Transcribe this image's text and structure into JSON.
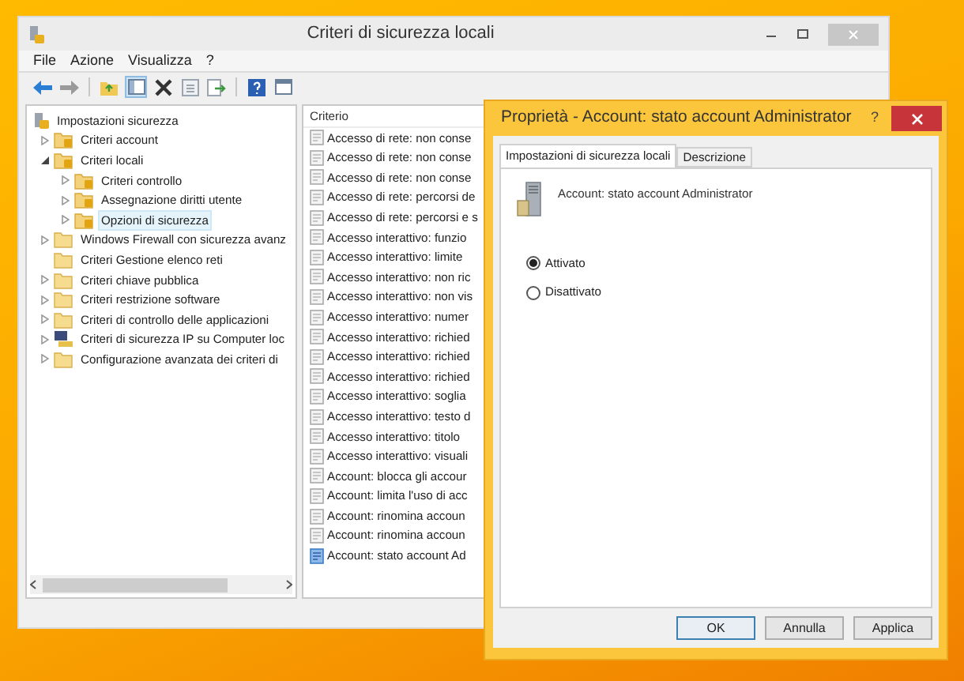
{
  "window": {
    "title": "Criteri di sicurezza locali"
  },
  "menu": [
    "File",
    "Azione",
    "Visualizza",
    "?"
  ],
  "tree": [
    {
      "label": "Impostazioni sicurezza",
      "kind": "root",
      "selected": false,
      "children": [
        {
          "label": "Criteri account",
          "kind": "lock-folder",
          "expanded": false,
          "selected": false
        },
        {
          "label": "Criteri locali",
          "kind": "lock-folder",
          "expanded": true,
          "selected": false,
          "children": [
            {
              "label": "Criteri controllo",
              "kind": "lock-folder",
              "expanded": false,
              "selected": false
            },
            {
              "label": "Assegnazione diritti utente",
              "kind": "lock-folder",
              "expanded": false,
              "selected": false
            },
            {
              "label": "Opzioni di sicurezza",
              "kind": "lock-folder",
              "expanded": false,
              "selected": true
            }
          ]
        },
        {
          "label": "Windows Firewall con sicurezza avanz",
          "kind": "folder",
          "expanded": false,
          "selected": false
        },
        {
          "label": "Criteri Gestione elenco reti",
          "kind": "folder",
          "selected": false
        },
        {
          "label": "Criteri chiave pubblica",
          "kind": "folder",
          "expanded": false,
          "selected": false
        },
        {
          "label": "Criteri restrizione software",
          "kind": "folder",
          "expanded": false,
          "selected": false
        },
        {
          "label": "Criteri di controllo delle applicazioni",
          "kind": "folder",
          "expanded": false,
          "selected": false
        },
        {
          "label": "Criteri di sicurezza IP su Computer loc",
          "kind": "ip",
          "expanded": false,
          "selected": false
        },
        {
          "label": "Configurazione avanzata dei criteri di",
          "kind": "folder",
          "expanded": false,
          "selected": false
        }
      ]
    }
  ],
  "list": {
    "columns": [
      "Criterio"
    ],
    "rows": [
      {
        "label": "Accesso di rete: non conse",
        "selected": false
      },
      {
        "label": "Accesso di rete: non conse",
        "selected": false
      },
      {
        "label": "Accesso di rete: non conse",
        "selected": false
      },
      {
        "label": "Accesso di rete: percorsi de",
        "selected": false
      },
      {
        "label": "Accesso di rete: percorsi e s",
        "selected": false
      },
      {
        "label": "Accesso interattivo: funzio",
        "selected": false
      },
      {
        "label": "Accesso interattivo: limite",
        "selected": false
      },
      {
        "label": "Accesso interattivo: non ric",
        "selected": false
      },
      {
        "label": "Accesso interattivo: non vis",
        "selected": false
      },
      {
        "label": "Accesso interattivo: numer",
        "selected": false
      },
      {
        "label": "Accesso interattivo: richied",
        "selected": false
      },
      {
        "label": "Accesso interattivo: richied",
        "selected": false
      },
      {
        "label": "Accesso interattivo: richied",
        "selected": false
      },
      {
        "label": "Accesso interattivo: soglia",
        "selected": false
      },
      {
        "label": "Accesso interattivo: testo d",
        "selected": false
      },
      {
        "label": "Accesso interattivo: titolo",
        "selected": false
      },
      {
        "label": "Accesso interattivo: visuali",
        "selected": false
      },
      {
        "label": "Account: blocca gli accour",
        "selected": false
      },
      {
        "label": "Account: limita l'uso di acc",
        "selected": false
      },
      {
        "label": "Account: rinomina accoun",
        "selected": false
      },
      {
        "label": "Account: rinomina accoun",
        "selected": false
      },
      {
        "label": "Account: stato account Ad",
        "selected": true
      }
    ]
  },
  "dialog": {
    "title": "Proprietà - Account: stato account Administrator",
    "help": "?",
    "tabs": [
      {
        "label": "Impostazioni di sicurezza locali",
        "selected": true
      },
      {
        "label": "Descrizione",
        "selected": false
      }
    ],
    "policy": "Account: stato account Administrator",
    "options": [
      {
        "label": "Attivato",
        "selected": true
      },
      {
        "label": "Disattivato",
        "selected": false
      }
    ],
    "buttons": [
      {
        "label": "OK",
        "default": true
      },
      {
        "label": "Annulla",
        "default": false
      },
      {
        "label": "Applica",
        "default": false
      }
    ]
  }
}
